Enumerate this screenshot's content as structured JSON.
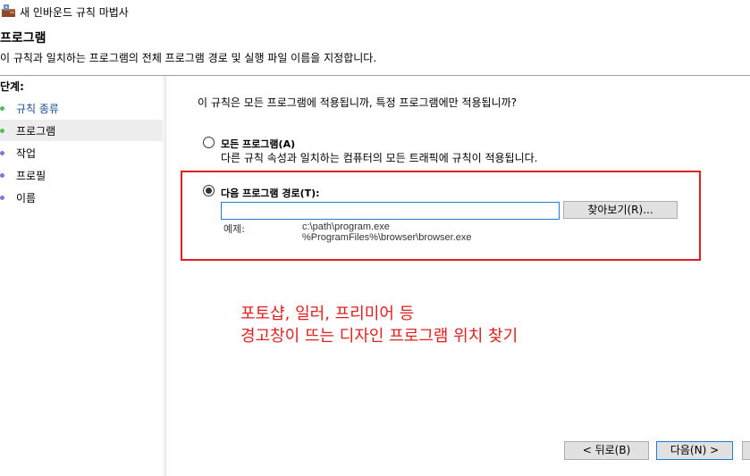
{
  "window": {
    "title": "새 인바운드 규칙 마법사"
  },
  "header": {
    "title": "프로그램",
    "description": "이 규칙과 일치하는 프로그램의 전체 프로그램 경로 및 실행 파일 이름을 지정합니다."
  },
  "sidebar": {
    "steps_label": "단계:",
    "items": [
      {
        "label": "규칙 종류",
        "state": "done"
      },
      {
        "label": "프로그램",
        "state": "current"
      },
      {
        "label": "작업",
        "state": "pending"
      },
      {
        "label": "프로필",
        "state": "pending"
      },
      {
        "label": "이름",
        "state": "pending"
      }
    ]
  },
  "main": {
    "question": "이 규칙은 모든 프로그램에 적용됩니까, 특정 프로그램에만 적용됩니까?",
    "option_all": {
      "label": "모든 프로그램(A)",
      "description": "다른 규칙 속성과 일치하는 컴퓨터의 모든 트래픽에 규칙이 적용됩니다.",
      "checked": false
    },
    "option_path": {
      "label": "다음 프로그램 경로(T):",
      "checked": true,
      "value": "",
      "browse_label": "찾아보기(R)...",
      "example_label": "예제:",
      "example_lines": [
        "c:\\path\\program.exe",
        "%ProgramFiles%\\browser\\browser.exe"
      ]
    },
    "annotation": {
      "line1": "포토샵, 일러, 프리미어 등",
      "line2": "경고창이 뜨는 디자인 프로그램 위치 찾기"
    }
  },
  "footer": {
    "back_label": "< 뒤로(B)",
    "next_label": "다음(N) >"
  },
  "colors": {
    "highlight": "#e02020",
    "done_dot": "#5cb85c",
    "pending_dot": "#7b7bd6",
    "focus_border": "#1e7fd6"
  }
}
